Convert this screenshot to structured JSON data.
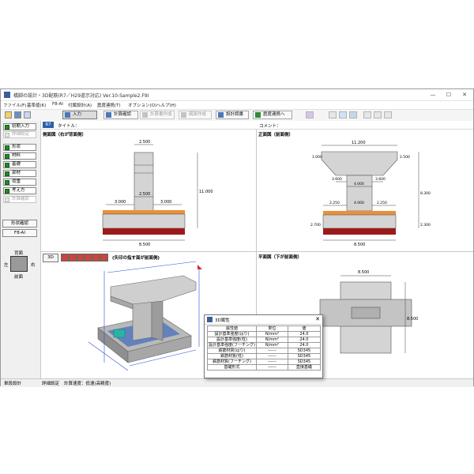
{
  "window": {
    "title": "橋脚の設計・3D配筋(R7／H29道示対応) Ver.10-Sample2.F9I",
    "controls": [
      "—",
      "☐",
      "✕"
    ]
  },
  "menu": [
    "ファイル(F)",
    "基準値(K)",
    "F8-AI",
    "付属設計(A)",
    "震度連携(T)",
    "オプション(O)",
    "ヘルプ(H)"
  ],
  "toolbar": {
    "input": "入力",
    "calc_confirm": "計算確認",
    "calc_run": "計算書作成",
    "drawing": "図面作成",
    "design_doc": "設計調書",
    "seismic_link": "震度連携へ"
  },
  "left_panel": {
    "initial_input": "初期入力",
    "items": [
      {
        "label": "詳細設定",
        "enabled": false
      },
      {
        "label": "形状",
        "enabled": true
      },
      {
        "label": "材料",
        "enabled": true
      },
      {
        "label": "基礎",
        "enabled": true
      },
      {
        "label": "部材",
        "enabled": true
      },
      {
        "label": "荷重",
        "enabled": true
      },
      {
        "label": "考え方",
        "enabled": true
      },
      {
        "label": "計算確認",
        "enabled": false
      }
    ],
    "shape_confirm": "形状確認",
    "f8ai": "F8-AI",
    "compass": {
      "back": "背面",
      "left": "左",
      "right": "右",
      "front": "前面"
    }
  },
  "header": {
    "tab": "R7",
    "title_label": "タイトル：",
    "comment_label": "コメント："
  },
  "views": {
    "side": {
      "label": "側面図（右が背面側）",
      "dims": [
        "2.500",
        "2.500",
        "3.000",
        "3.000",
        "11.000",
        "8.500"
      ]
    },
    "front": {
      "label": "正面図（前面側）",
      "dims": [
        "11.200",
        "1.000",
        "2.500",
        "3.600",
        "4.000",
        "3.600",
        "8.300",
        "2.250",
        "4.000",
        "2.250",
        "2.700",
        "2.300",
        "8.500"
      ]
    },
    "view3d": {
      "button": "3D",
      "label": "(矢印の指す面が前面側)"
    },
    "plan": {
      "label": "平面図（下が前面側）",
      "dims": [
        "8.500",
        "8.500"
      ]
    }
  },
  "status": {
    "left": "単段設計",
    "mid1": "詳細設定",
    "mid2": "計算速度：低速(高精度)"
  },
  "dialog": {
    "title": "3D属性",
    "headers": [
      "属性値",
      "単位",
      "値"
    ],
    "rows": [
      [
        "設計基準強度(はり)",
        "N/mm²",
        "24.0"
      ],
      [
        "設計基準強度(柱)",
        "N/mm²",
        "24.0"
      ],
      [
        "設計基準強度(フーチング)",
        "N/mm²",
        "24.0"
      ],
      [
        "鉄筋材質(はり)",
        "------",
        "SD345"
      ],
      [
        "鉄筋材質(柱)",
        "------",
        "SD345"
      ],
      [
        "鉄筋材質(フーチング)",
        "------",
        "SD345"
      ],
      [
        "基礎形式",
        "------",
        "直接基礎"
      ]
    ]
  },
  "colors": {
    "pier": "#d0d0d0",
    "soil": "#e8913a",
    "base": "#9b1b1b",
    "check": "#1f8a2e",
    "pane_label": "#2c5fa8"
  }
}
